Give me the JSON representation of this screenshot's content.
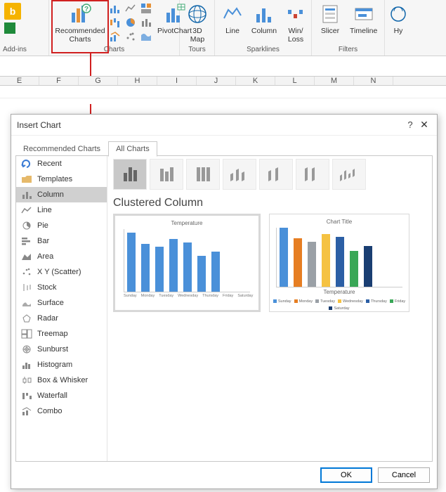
{
  "ribbon": {
    "addins_label": "Add-ins",
    "group_charts": "Charts",
    "group_tours": "Tours",
    "group_sparklines": "Sparklines",
    "group_filters": "Filters",
    "recommended": "Recommended\nCharts",
    "pivotchart": "PivotChart",
    "map3d": "3D\nMap",
    "line": "Line",
    "column": "Column",
    "winloss": "Win/\nLoss",
    "slicer": "Slicer",
    "timeline": "Timeline",
    "hyper": "Hy"
  },
  "columns": [
    "E",
    "F",
    "G",
    "H",
    "I",
    "J",
    "K",
    "L",
    "M",
    "N"
  ],
  "dialog": {
    "title": "Insert Chart",
    "tab_recommended": "Recommended Charts",
    "tab_all": "All Charts",
    "ok": "OK",
    "cancel": "Cancel"
  },
  "side_items": [
    {
      "icon": "recent",
      "label": "Recent"
    },
    {
      "icon": "templates",
      "label": "Templates"
    },
    {
      "icon": "column",
      "label": "Column"
    },
    {
      "icon": "line",
      "label": "Line"
    },
    {
      "icon": "pie",
      "label": "Pie"
    },
    {
      "icon": "bar",
      "label": "Bar"
    },
    {
      "icon": "area",
      "label": "Area"
    },
    {
      "icon": "scatter",
      "label": "X Y (Scatter)"
    },
    {
      "icon": "stock",
      "label": "Stock"
    },
    {
      "icon": "surface",
      "label": "Surface"
    },
    {
      "icon": "radar",
      "label": "Radar"
    },
    {
      "icon": "treemap",
      "label": "Treemap"
    },
    {
      "icon": "sunburst",
      "label": "Sunburst"
    },
    {
      "icon": "histogram",
      "label": "Histogram"
    },
    {
      "icon": "box",
      "label": "Box & Whisker"
    },
    {
      "icon": "waterfall",
      "label": "Waterfall"
    },
    {
      "icon": "combo",
      "label": "Combo"
    }
  ],
  "selected_chart_type": "Clustered Column",
  "chart_data": [
    {
      "type": "bar",
      "title": "Temperature",
      "xlabel": "",
      "ylabel": "",
      "ylim": [
        0,
        4.0
      ],
      "categories": [
        "Sunday",
        "Monday",
        "Tuesday",
        "Wednesday",
        "Thursday",
        "Friday",
        "Saturday"
      ],
      "values": [
        3.8,
        3.1,
        2.9,
        3.4,
        3.2,
        2.3,
        2.6
      ],
      "color": "#4a90d9"
    },
    {
      "type": "bar",
      "title": "Chart Title",
      "xlabel": "Temperature",
      "ylabel": "",
      "ylim": [
        0,
        4.0
      ],
      "categories": [
        "Sunday",
        "Monday",
        "Tuesday",
        "Wednesday",
        "Thursday",
        "Friday",
        "Saturday"
      ],
      "values": [
        3.8,
        3.1,
        2.9,
        3.4,
        3.2,
        2.3,
        2.6
      ],
      "series_colors": [
        "#4a90d9",
        "#e67e22",
        "#9aa0a6",
        "#f5c242",
        "#2c5fa5",
        "#3aa757",
        "#1a3e72"
      ]
    }
  ]
}
